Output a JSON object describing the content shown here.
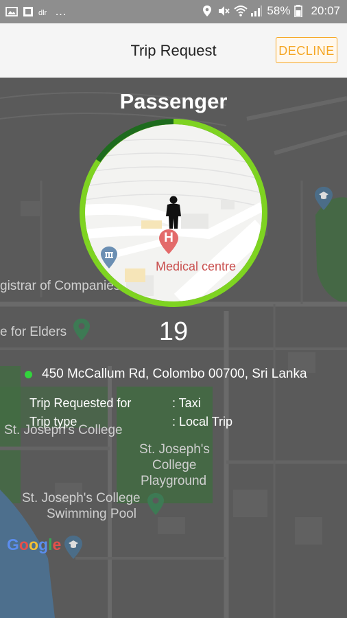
{
  "status_bar": {
    "left_glyphs": "…",
    "battery": "58%",
    "time": "20:07"
  },
  "app_bar": {
    "title": "Trip Request",
    "decline_label": "DECLINE"
  },
  "passenger_title": "Passenger",
  "circle_map": {
    "poi_label": "Medical centre",
    "hospital_letter": "H"
  },
  "countdown": "19",
  "pickup": {
    "address": "450 McCallum Rd, Colombo 00700, Sri Lanka"
  },
  "trip_info": [
    {
      "label": "Trip Requested for",
      "value": ": Taxi"
    },
    {
      "label": "Trip type",
      "value": ": Local Trip"
    }
  ],
  "map_labels": {
    "registrar": "gistrar of Companies",
    "elders": "e for Elders",
    "college": "St. Joseph's College",
    "playground_1": "St. Joseph's",
    "playground_2": "College",
    "playground_3": "Playground",
    "pool_1": "St. Joseph's College",
    "pool_2": "Swimming Pool",
    "google": "Google"
  },
  "colors": {
    "accent_green": "#7ed321",
    "dark_green": "#1e6b1e",
    "decline_orange": "#f5a623",
    "dot_green": "#32d43c"
  }
}
